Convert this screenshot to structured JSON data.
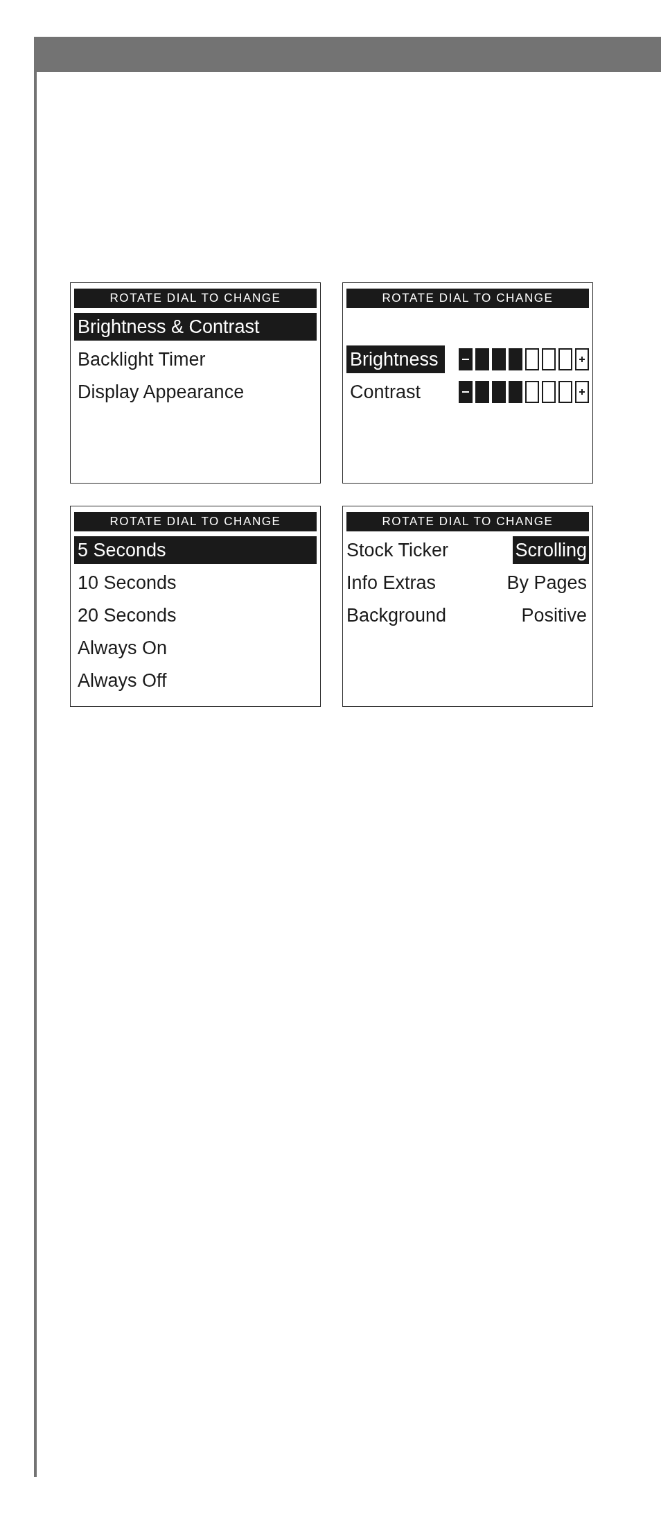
{
  "screens": [
    {
      "kind": "menu",
      "title": "ROTATE DIAL TO CHANGE",
      "items": [
        {
          "label": "Brightness & Contrast",
          "selected": true
        },
        {
          "label": "Backlight Timer",
          "selected": false
        },
        {
          "label": "Display Appearance",
          "selected": false
        }
      ]
    },
    {
      "kind": "levels",
      "title": "ROTATE DIAL TO CHANGE",
      "rows": [
        {
          "label": "Brightness",
          "selected": true,
          "level": 0.5
        },
        {
          "label": "Contrast",
          "selected": false,
          "level": 0.5
        }
      ]
    },
    {
      "kind": "menu",
      "title": "ROTATE DIAL TO CHANGE",
      "items": [
        {
          "label": "5 Seconds",
          "selected": true
        },
        {
          "label": "10 Seconds",
          "selected": false
        },
        {
          "label": "20 Seconds",
          "selected": false
        },
        {
          "label": "Always On",
          "selected": false
        },
        {
          "label": "Always Off",
          "selected": false
        }
      ]
    },
    {
      "kind": "options",
      "title": "ROTATE DIAL TO CHANGE",
      "rows": [
        {
          "label": "Stock Ticker",
          "value": "Scrolling",
          "selected": true
        },
        {
          "label": "Info Extras",
          "value": "By Pages",
          "selected": false
        },
        {
          "label": "Background",
          "value": "Positive",
          "selected": false
        }
      ]
    }
  ]
}
